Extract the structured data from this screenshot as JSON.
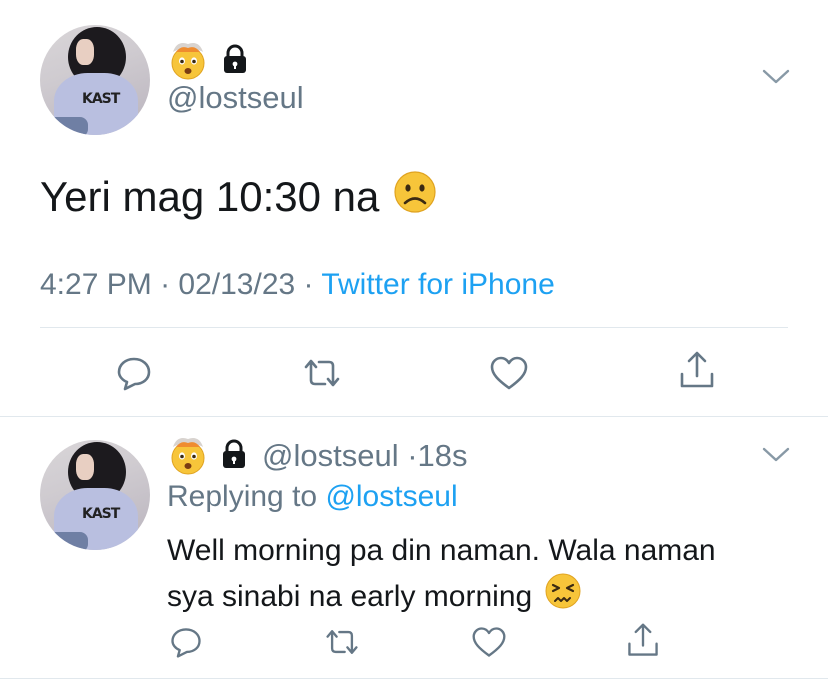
{
  "main_tweet": {
    "handle": "@lostseul",
    "text": "Yeri mag 10:30 na",
    "text_emoji": "frowning-face",
    "time": "4:27 PM",
    "separator": "·",
    "date": "02/13/23",
    "source": "Twitter for iPhone",
    "name_emoji": "exploding-head",
    "protected": true
  },
  "reply_tweet": {
    "handle": "@lostseul",
    "separator": "·",
    "age": "18s",
    "replying_prefix": "Replying to",
    "replying_to": "@lostseul",
    "text_line1": "Well morning pa din naman. Wala naman",
    "text_line2": "sya sinabi na early morning",
    "text_emoji": "persevering-face",
    "name_emoji": "exploding-head",
    "protected": true
  },
  "avatar_print": "KAST",
  "actions": [
    "reply-icon",
    "retweet-icon",
    "like-icon",
    "share-icon"
  ],
  "colors": {
    "link": "#1da1f2",
    "secondary_text": "#657786",
    "primary_text": "#14171a",
    "divider": "#e1e8ed",
    "icon": "#657786"
  }
}
